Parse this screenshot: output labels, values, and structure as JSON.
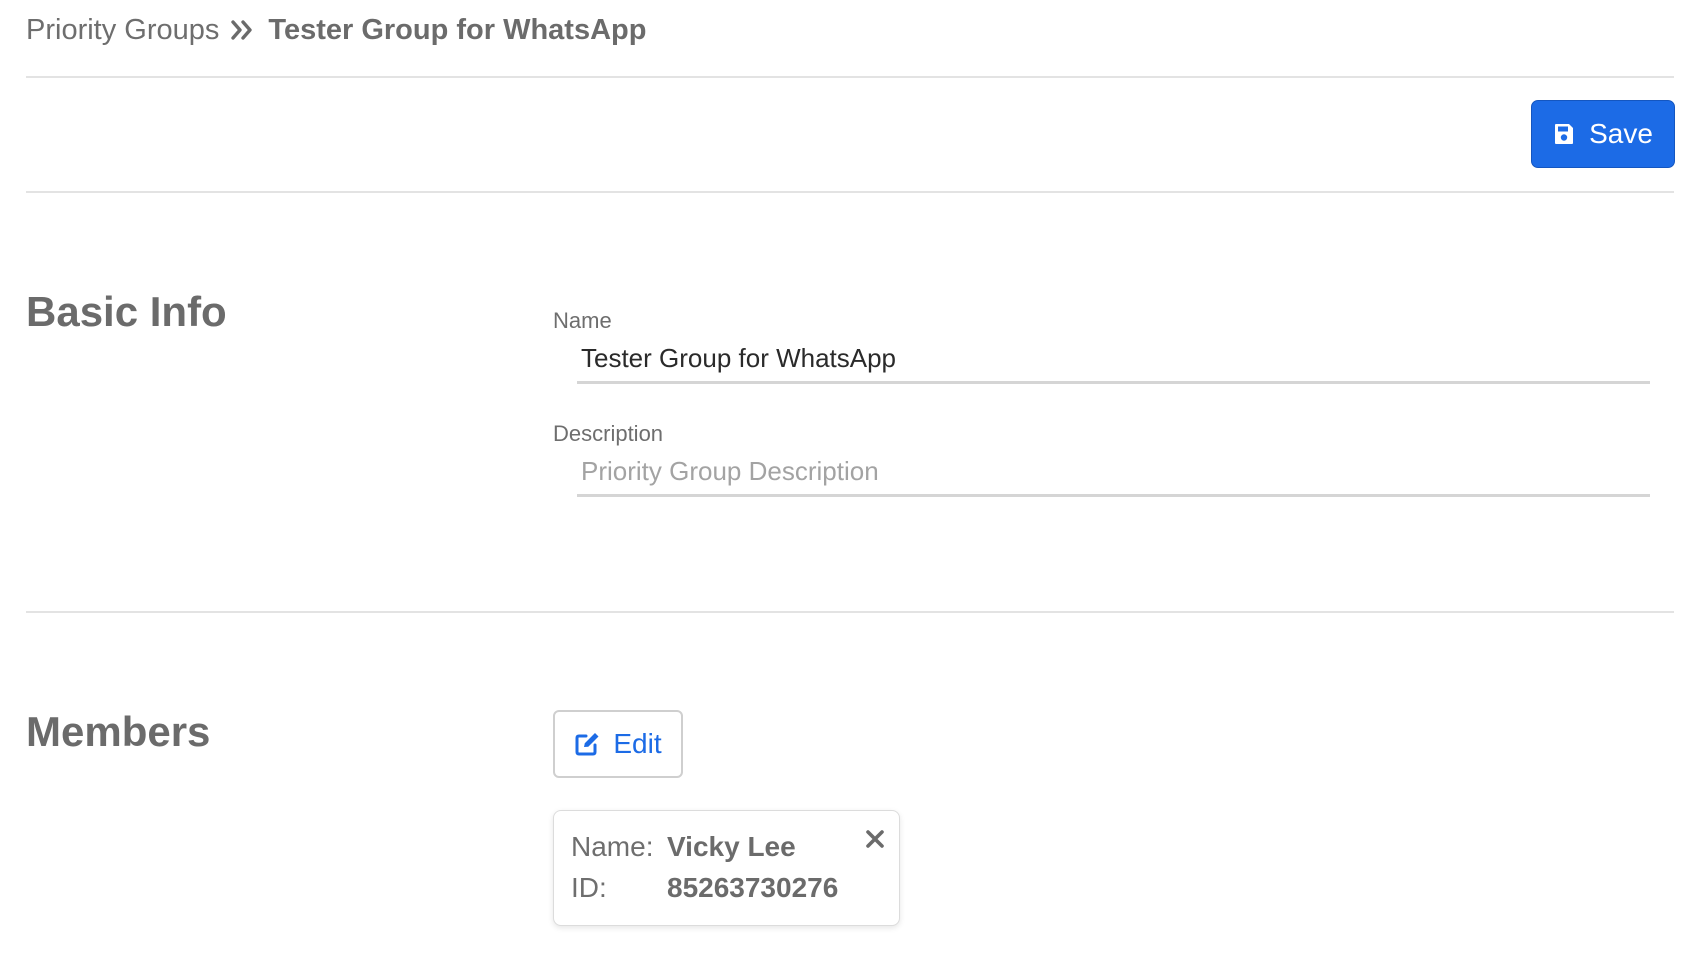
{
  "breadcrumb": {
    "parent": "Priority Groups",
    "separator_icon": "double-chevron-right-icon",
    "current": "Tester Group for WhatsApp"
  },
  "toolbar": {
    "save_label": "Save",
    "save_icon": "floppy-disk-icon"
  },
  "basic_info": {
    "title": "Basic Info",
    "name_label": "Name",
    "name_value": "Tester Group for WhatsApp",
    "description_label": "Description",
    "description_value": "",
    "description_placeholder": "Priority Group Description"
  },
  "members": {
    "title": "Members",
    "edit_label": "Edit",
    "edit_icon": "pen-to-square-icon",
    "items": [
      {
        "name_key": "Name:",
        "name": "Vicky Lee",
        "id_key": "ID:",
        "id": "85263730276"
      }
    ]
  },
  "colors": {
    "accent": "#1c6be6",
    "text": "#6b6b6b",
    "divider": "#e3e3e3"
  }
}
